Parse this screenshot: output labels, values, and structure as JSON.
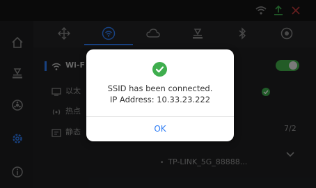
{
  "status_bar": {
    "icons": [
      "wifi-icon",
      "upload-icon",
      "signal-icon"
    ]
  },
  "sidebar": {
    "items": [
      "home-icon",
      "printer-icon",
      "filament-icon",
      "settings-icon",
      "info-icon"
    ],
    "active": 3
  },
  "tabs": {
    "items": [
      "move-icon",
      "wifi-icon",
      "cloud-icon",
      "printer-icon",
      "bluetooth-icon",
      "camera-icon"
    ],
    "active": 1
  },
  "network_menu": {
    "wifi_label": "Wi-F",
    "ethernet_label": "以太",
    "hotspot_label": "热点",
    "static_label": "静态"
  },
  "page_indicator": "7/2",
  "network_name": "TP-LINK_5G_88888...",
  "dialog": {
    "line1": "SSID has been connected.",
    "line2": "IP Address: 10.33.23.222",
    "ok": "OK"
  },
  "colors": {
    "accent": "#2e7df5",
    "success": "#3fae4e",
    "toggle": "#44b04c"
  }
}
